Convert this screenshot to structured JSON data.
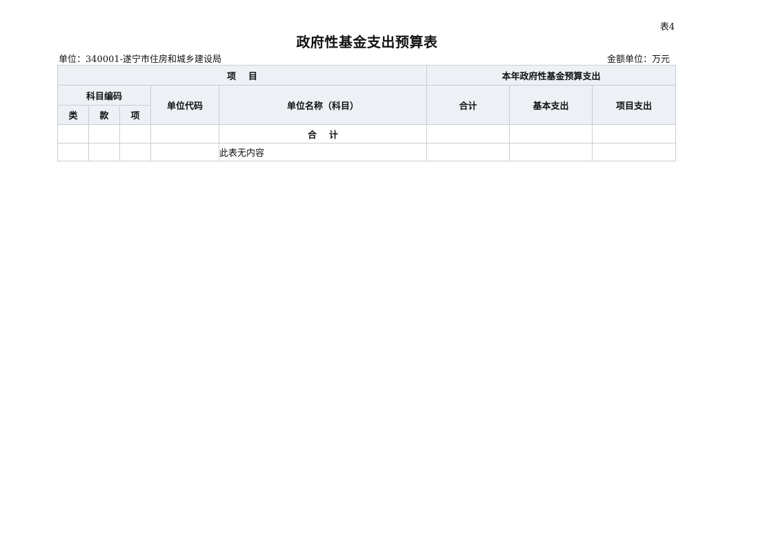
{
  "header": {
    "table_no": "表4",
    "title": "政府性基金支出预算表",
    "unit": "单位：340001-遂宁市住房和城乡建设局",
    "amount_unit": "金额单位：万元"
  },
  "table": {
    "group_item": "项    目",
    "group_budget": "本年政府性基金预算支出",
    "subject_code": "科目编码",
    "col_class": "类",
    "col_section": "款",
    "col_item": "项",
    "col_unit_code": "单位代码",
    "col_unit_name": "单位名称（科目）",
    "col_total": "合计",
    "col_basic": "基本支出",
    "col_project": "项目支出",
    "total_row_label": "合    计",
    "empty_note": "此表无内容"
  }
}
